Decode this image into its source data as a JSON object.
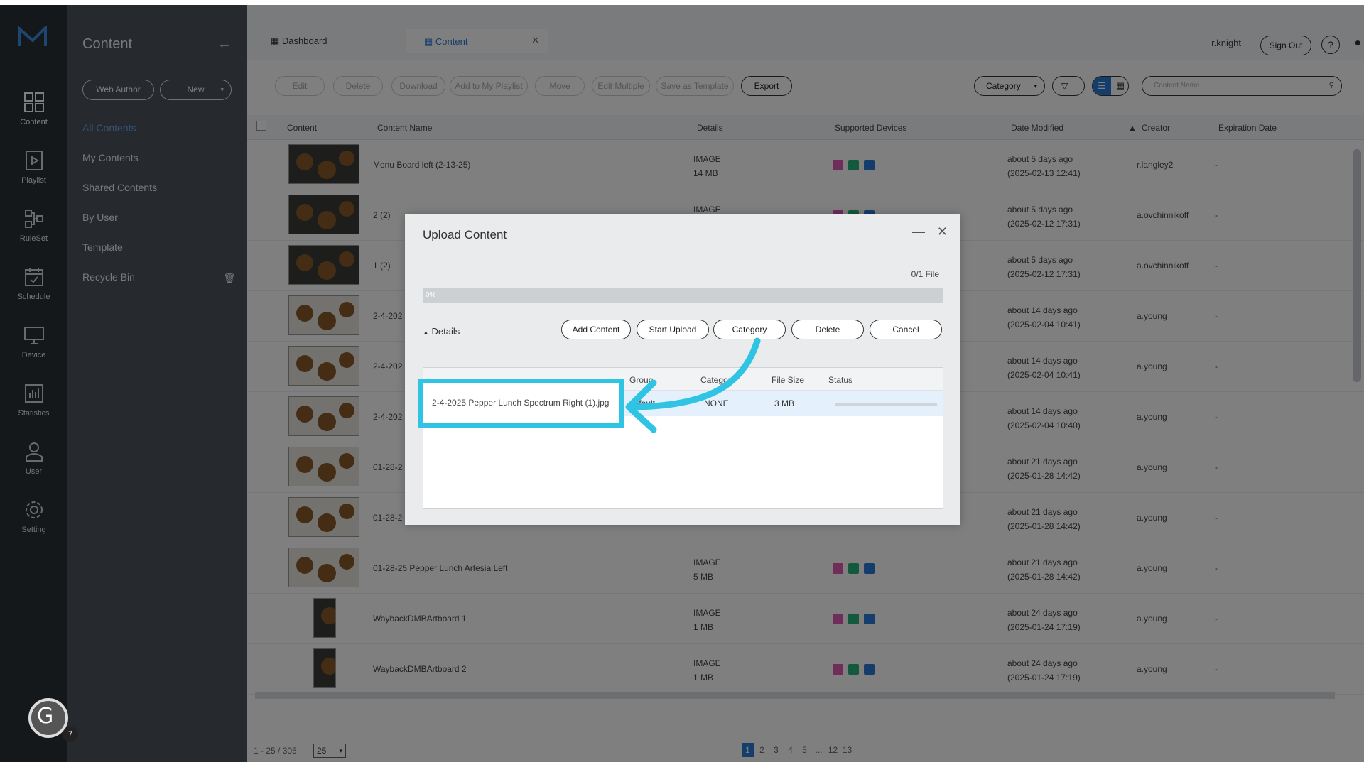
{
  "nav": {
    "items": [
      {
        "label": "Content",
        "icon": "grid-icon"
      },
      {
        "label": "Playlist",
        "icon": "playlist-icon"
      },
      {
        "label": "RuleSet",
        "icon": "ruleset-icon"
      },
      {
        "label": "Schedule",
        "icon": "calendar-icon"
      },
      {
        "label": "Device",
        "icon": "monitor-icon"
      },
      {
        "label": "Statistics",
        "icon": "chart-icon"
      },
      {
        "label": "User",
        "icon": "user-icon"
      },
      {
        "label": "Setting",
        "icon": "gear-icon"
      }
    ]
  },
  "sidebar": {
    "title": "Content",
    "web_author": "Web Author",
    "new": "New",
    "items": [
      {
        "label": "All Contents"
      },
      {
        "label": "My Contents"
      },
      {
        "label": "Shared Contents"
      },
      {
        "label": "By User"
      },
      {
        "label": "Template"
      },
      {
        "label": "Recycle Bin"
      }
    ]
  },
  "tabs": [
    {
      "label": "Dashboard"
    },
    {
      "label": "Content"
    }
  ],
  "header": {
    "user": "r.knight",
    "sign_out": "Sign Out",
    "help": "?"
  },
  "toolbar": {
    "buttons": [
      "Edit",
      "Delete",
      "Download",
      "Add to My Playlist",
      "Move",
      "Edit Multiple",
      "Save as Template",
      "Export"
    ],
    "category": "Category",
    "search_placeholder": "Content Name"
  },
  "table": {
    "columns": [
      "Content",
      "Content Name",
      "Details",
      "Supported Devices",
      "Date Modified",
      "Creator",
      "Expiration Date"
    ],
    "rows": [
      {
        "name": "Menu Board left (2-13-25)",
        "type": "IMAGE",
        "size": "14 MB",
        "ago": "about 5 days ago",
        "date": "(2025-02-13 12:41)",
        "creator": "r.langley2",
        "expiration": "-"
      },
      {
        "name": "2 (2)",
        "type": "IMAGE",
        "size": "",
        "ago": "about 5 days ago",
        "date": "(2025-02-12 17:31)",
        "creator": "a.ovchinnikoff",
        "expiration": "-"
      },
      {
        "name": "1 (2)",
        "type": "",
        "size": "",
        "ago": "about 5 days ago",
        "date": "(2025-02-12 17:31)",
        "creator": "a.ovchinnikoff",
        "expiration": "-"
      },
      {
        "name": "2-4-202",
        "type": "",
        "size": "",
        "ago": "about 14 days ago",
        "date": "(2025-02-04 10:41)",
        "creator": "a.young",
        "expiration": "-"
      },
      {
        "name": "2-4-202",
        "type": "",
        "size": "",
        "ago": "about 14 days ago",
        "date": "(2025-02-04 10:41)",
        "creator": "a.young",
        "expiration": "-"
      },
      {
        "name": "2-4-202",
        "type": "",
        "size": "",
        "ago": "about 14 days ago",
        "date": "(2025-02-04 10:40)",
        "creator": "a.young",
        "expiration": "-"
      },
      {
        "name": "01-28-2",
        "type": "",
        "size": "",
        "ago": "about 21 days ago",
        "date": "(2025-01-28 14:42)",
        "creator": "a.young",
        "expiration": "-"
      },
      {
        "name": "01-28-2",
        "type": "",
        "size": "",
        "ago": "about 21 days ago",
        "date": "(2025-01-28 14:42)",
        "creator": "a.young",
        "expiration": "-"
      },
      {
        "name": "01-28-25 Pepper Lunch Artesia Left",
        "type": "IMAGE",
        "size": "5 MB",
        "ago": "about 21 days ago",
        "date": "(2025-01-28 14:42)",
        "creator": "a.young",
        "expiration": "-"
      },
      {
        "name": "WaybackDMBArtboard 1",
        "type": "IMAGE",
        "size": "1 MB",
        "ago": "about 24 days ago",
        "date": "(2025-01-24 17:19)",
        "creator": "a.young",
        "expiration": "-"
      },
      {
        "name": "WaybackDMBArtboard 2",
        "type": "IMAGE",
        "size": "1 MB",
        "ago": "about 24 days ago",
        "date": "(2025-01-24 17:19)",
        "creator": "a.young",
        "expiration": "-"
      }
    ],
    "device_badges": [
      "SS",
      "S6",
      "S4"
    ],
    "device_colors": [
      "#e05bb5",
      "#27b37a",
      "#2a7bd9"
    ]
  },
  "footer": {
    "range": "1 - 25 / 305",
    "page_size": "25",
    "pages": [
      "1",
      "2",
      "3",
      "4",
      "5",
      "...",
      "12",
      "13"
    ]
  },
  "dialog": {
    "title": "Upload Content",
    "file_count": "0/1 File",
    "progress_label": "0%",
    "progress": 0,
    "details_label": "Details",
    "buttons": [
      "Add Content",
      "Start Upload",
      "Category",
      "Delete",
      "Cancel"
    ],
    "columns": [
      "Group",
      "Category",
      "File Size",
      "Status"
    ],
    "file": {
      "name": "2-4-2025 Pepper Lunch Spectrum Right (1).jpg",
      "group": "default",
      "category": "NONE",
      "size": "3 MB"
    }
  },
  "badge": {
    "count": "7"
  },
  "colors": {
    "highlight": "#2fc3e4",
    "accent": "#2a7bd9"
  }
}
